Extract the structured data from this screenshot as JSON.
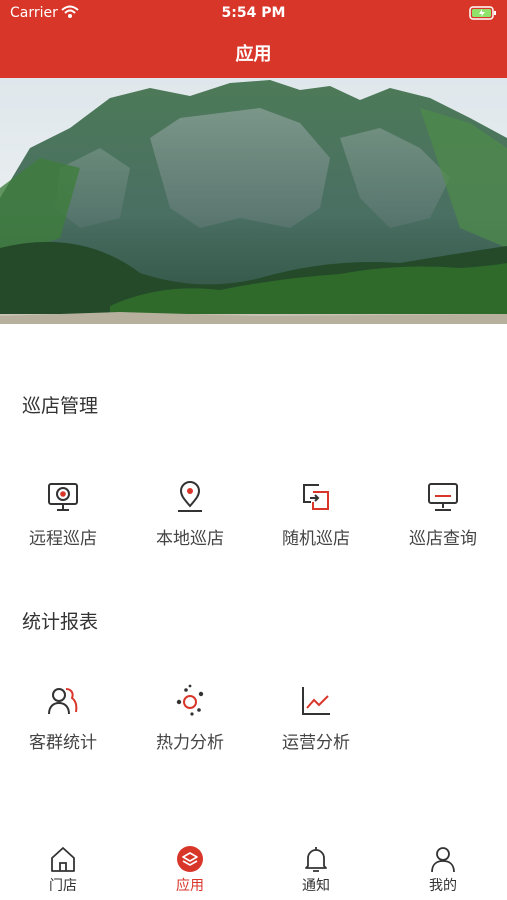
{
  "status_bar": {
    "carrier": "Carrier",
    "time": "5:54 PM"
  },
  "nav": {
    "title": "应用"
  },
  "sections": [
    {
      "title": "巡店管理",
      "items": [
        {
          "label": "远程巡店",
          "icon": "remote-camera-icon"
        },
        {
          "label": "本地巡店",
          "icon": "location-pin-icon"
        },
        {
          "label": "随机巡店",
          "icon": "random-share-icon"
        },
        {
          "label": "巡店查询",
          "icon": "monitor-query-icon"
        }
      ]
    },
    {
      "title": "统计报表",
      "items": [
        {
          "label": "客群统计",
          "icon": "customer-group-icon"
        },
        {
          "label": "热力分析",
          "icon": "heat-map-icon"
        },
        {
          "label": "运营分析",
          "icon": "line-chart-icon"
        }
      ]
    }
  ],
  "tabbar": {
    "active": "应用",
    "items": [
      {
        "label": "门店",
        "icon": "home-icon"
      },
      {
        "label": "应用",
        "icon": "apps-icon"
      },
      {
        "label": "通知",
        "icon": "bell-icon"
      },
      {
        "label": "我的",
        "icon": "profile-icon"
      }
    ]
  },
  "colors": {
    "accent": "#d9362a",
    "icon_dark": "#333333",
    "background": "#ffffff"
  }
}
